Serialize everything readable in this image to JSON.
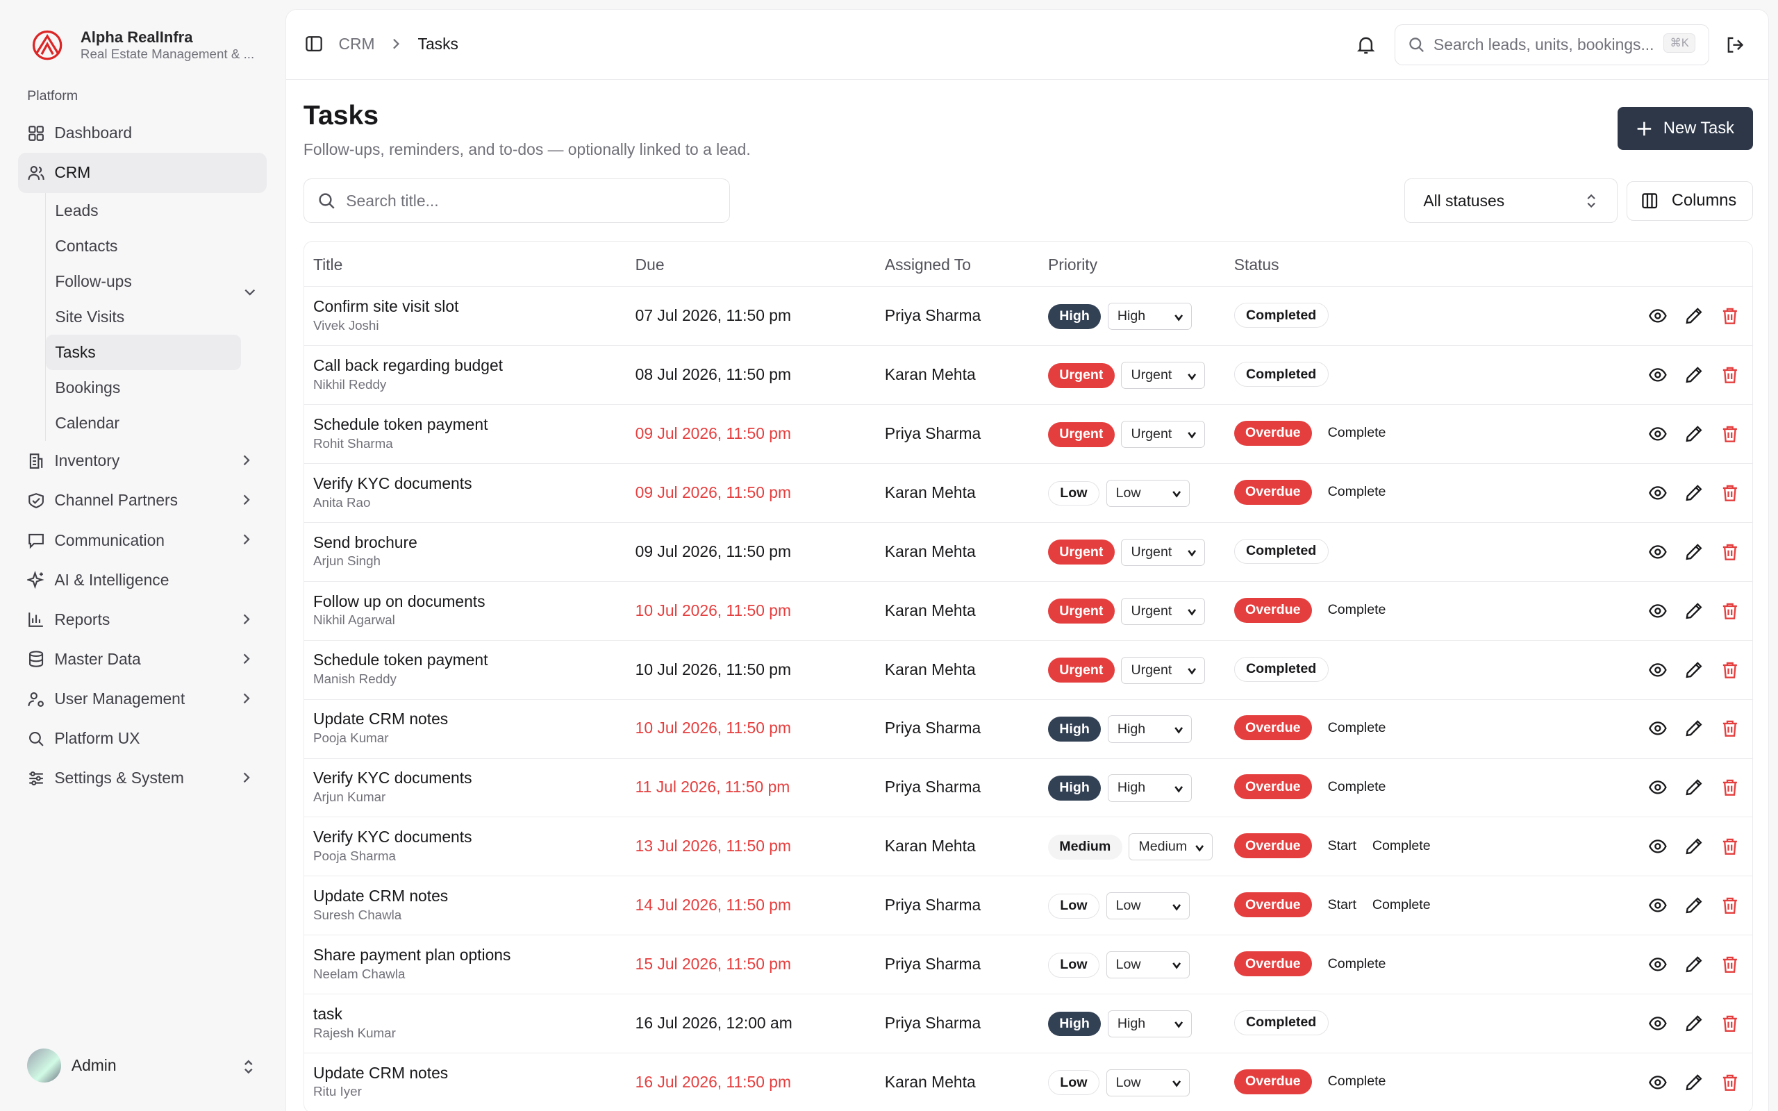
{
  "app": {
    "name": "Alpha RealInfra",
    "subtitle": "Real Estate Management & ..."
  },
  "sidebar": {
    "section_label": "Platform",
    "items": [
      {
        "label": "Dashboard",
        "icon": "grid-icon"
      },
      {
        "label": "CRM",
        "icon": "users-icon",
        "active": true
      }
    ],
    "crm_sub": [
      "Leads",
      "Contacts",
      "Follow-ups",
      "Site Visits",
      "Tasks",
      "Bookings",
      "Calendar"
    ],
    "more": [
      {
        "label": "Inventory",
        "icon": "building-icon",
        "chev": true
      },
      {
        "label": "Channel Partners",
        "icon": "handshake-icon",
        "chev": true
      },
      {
        "label": "Communication",
        "icon": "message-icon",
        "chev": true
      },
      {
        "label": "AI & Intelligence",
        "icon": "sparkles-icon",
        "chev": false
      },
      {
        "label": "Reports",
        "icon": "bar-chart-icon",
        "chev": true
      },
      {
        "label": "Master Data",
        "icon": "database-icon",
        "chev": true
      },
      {
        "label": "User Management",
        "icon": "user-cog-icon",
        "chev": true
      },
      {
        "label": "Platform UX",
        "icon": "search-icon",
        "chev": false
      },
      {
        "label": "Settings & System",
        "icon": "sliders-icon",
        "chev": true
      }
    ],
    "user": "Admin"
  },
  "header": {
    "breadcrumb": [
      "CRM",
      "Tasks"
    ],
    "search_placeholder": "Search leads, units, bookings...",
    "shortcut": "⌘K"
  },
  "page": {
    "title": "Tasks",
    "description": "Follow-ups, reminders, and to-dos — optionally linked to a lead.",
    "new_button": "New Task",
    "search_placeholder": "Search title...",
    "status_filter": "All statuses",
    "columns_button": "Columns"
  },
  "table": {
    "headers": [
      "Title",
      "Due",
      "Assigned To",
      "Priority",
      "Status"
    ],
    "rows": [
      {
        "title": "Confirm site visit slot",
        "lead": "Vivek Joshi",
        "due": "07 Jul 2026, 11:50 pm",
        "overdue_date": false,
        "assigned": "Priya Sharma",
        "priority": "High",
        "status": "Completed",
        "actions": []
      },
      {
        "title": "Call back regarding budget",
        "lead": "Nikhil Reddy",
        "due": "08 Jul 2026, 11:50 pm",
        "overdue_date": false,
        "assigned": "Karan Mehta",
        "priority": "Urgent",
        "status": "Completed",
        "actions": []
      },
      {
        "title": "Schedule token payment",
        "lead": "Rohit Sharma",
        "due": "09 Jul 2026, 11:50 pm",
        "overdue_date": true,
        "assigned": "Priya Sharma",
        "priority": "Urgent",
        "status": "Overdue",
        "actions": [
          "Complete"
        ]
      },
      {
        "title": "Verify KYC documents",
        "lead": "Anita Rao",
        "due": "09 Jul 2026, 11:50 pm",
        "overdue_date": true,
        "assigned": "Karan Mehta",
        "priority": "Low",
        "status": "Overdue",
        "actions": [
          "Complete"
        ]
      },
      {
        "title": "Send brochure",
        "lead": "Arjun Singh",
        "due": "09 Jul 2026, 11:50 pm",
        "overdue_date": false,
        "assigned": "Karan Mehta",
        "priority": "Urgent",
        "status": "Completed",
        "actions": []
      },
      {
        "title": "Follow up on documents",
        "lead": "Nikhil Agarwal",
        "due": "10 Jul 2026, 11:50 pm",
        "overdue_date": true,
        "assigned": "Karan Mehta",
        "priority": "Urgent",
        "status": "Overdue",
        "actions": [
          "Complete"
        ]
      },
      {
        "title": "Schedule token payment",
        "lead": "Manish Reddy",
        "due": "10 Jul 2026, 11:50 pm",
        "overdue_date": false,
        "assigned": "Karan Mehta",
        "priority": "Urgent",
        "status": "Completed",
        "actions": []
      },
      {
        "title": "Update CRM notes",
        "lead": "Pooja Kumar",
        "due": "10 Jul 2026, 11:50 pm",
        "overdue_date": true,
        "assigned": "Priya Sharma",
        "priority": "High",
        "status": "Overdue",
        "actions": [
          "Complete"
        ]
      },
      {
        "title": "Verify KYC documents",
        "lead": "Arjun Kumar",
        "due": "11 Jul 2026, 11:50 pm",
        "overdue_date": true,
        "assigned": "Priya Sharma",
        "priority": "High",
        "status": "Overdue",
        "actions": [
          "Complete"
        ]
      },
      {
        "title": "Verify KYC documents",
        "lead": "Pooja Sharma",
        "due": "13 Jul 2026, 11:50 pm",
        "overdue_date": true,
        "assigned": "Karan Mehta",
        "priority": "Medium",
        "status": "Overdue",
        "actions": [
          "Start",
          "Complete"
        ]
      },
      {
        "title": "Update CRM notes",
        "lead": "Suresh Chawla",
        "due": "14 Jul 2026, 11:50 pm",
        "overdue_date": true,
        "assigned": "Priya Sharma",
        "priority": "Low",
        "status": "Overdue",
        "actions": [
          "Start",
          "Complete"
        ]
      },
      {
        "title": "Share payment plan options",
        "lead": "Neelam Chawla",
        "due": "15 Jul 2026, 11:50 pm",
        "overdue_date": true,
        "assigned": "Priya Sharma",
        "priority": "Low",
        "status": "Overdue",
        "actions": [
          "Complete"
        ]
      },
      {
        "title": "task",
        "lead": "Rajesh Kumar",
        "due": "16 Jul 2026, 12:00 am",
        "overdue_date": false,
        "assigned": "Priya Sharma",
        "priority": "High",
        "status": "Completed",
        "actions": []
      },
      {
        "title": "Update CRM notes",
        "lead": "Ritu Iyer",
        "due": "16 Jul 2026, 11:50 pm",
        "overdue_date": true,
        "assigned": "Karan Mehta",
        "priority": "Low",
        "status": "Overdue",
        "actions": [
          "Complete"
        ]
      }
    ]
  },
  "colors": {
    "accent": "#2d3748",
    "danger": "#e53e3e",
    "high": "#334155"
  }
}
